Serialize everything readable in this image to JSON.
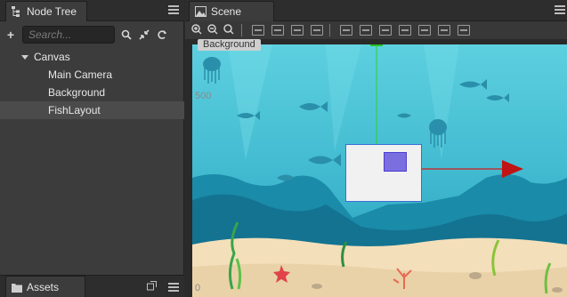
{
  "node_tree": {
    "title": "Node Tree",
    "search_placeholder": "Search...",
    "items": [
      {
        "label": "Canvas",
        "level": 0,
        "expanded": true,
        "selected": false
      },
      {
        "label": "Main Camera",
        "level": 1,
        "selected": false
      },
      {
        "label": "Background",
        "level": 1,
        "selected": false
      },
      {
        "label": "FishLayout",
        "level": 1,
        "selected": true
      }
    ]
  },
  "assets": {
    "title": "Assets"
  },
  "scene": {
    "title": "Scene",
    "ruler": {
      "y_top": "500",
      "y_bottom": "0"
    },
    "selected_node_label": "Background"
  },
  "icons": {
    "add": "plus-icon",
    "search": "search-icon",
    "collapse": "collapse-icon",
    "refresh": "refresh-icon",
    "zoom_in": "zoom-in-icon",
    "zoom_out": "zoom-out-icon",
    "zoom_reset": "zoom-reset-icon"
  },
  "colors": {
    "accent_green": "#25c225",
    "x_axis_red": "#d11a1a",
    "y_axis_green": "#2fd12f",
    "selection_blue": "#3b6fd4",
    "water_top": "#53c7d9",
    "water_mid": "#2aa4bf",
    "seabed": "#f0dcb7"
  }
}
